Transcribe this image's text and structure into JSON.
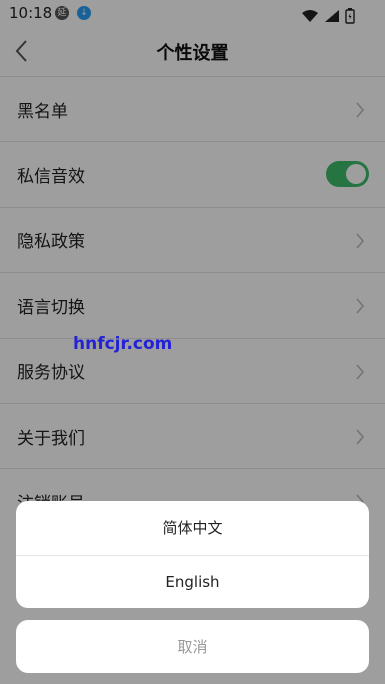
{
  "status_bar": {
    "time": "10:18",
    "badge_a": "延",
    "badge_b": "↓"
  },
  "header": {
    "title": "个性设置"
  },
  "settings": {
    "items": [
      {
        "label": "黑名单",
        "control": "chevron"
      },
      {
        "label": "私信音效",
        "control": "toggle",
        "toggle_on": true
      },
      {
        "label": "隐私政策",
        "control": "chevron"
      },
      {
        "label": "语言切换",
        "control": "chevron"
      },
      {
        "label": "服务协议",
        "control": "chevron"
      },
      {
        "label": "关于我们",
        "control": "chevron"
      },
      {
        "label": "注销账号",
        "control": "chevron"
      }
    ]
  },
  "watermark": "hnfcjr.com",
  "language_sheet": {
    "options": [
      "简体中文",
      "English"
    ],
    "cancel_label": "取消"
  },
  "colors": {
    "toggle_on": "#3dbb6b",
    "overlay": "rgba(0,0,0,0.38)",
    "watermark": "#2323d6"
  }
}
